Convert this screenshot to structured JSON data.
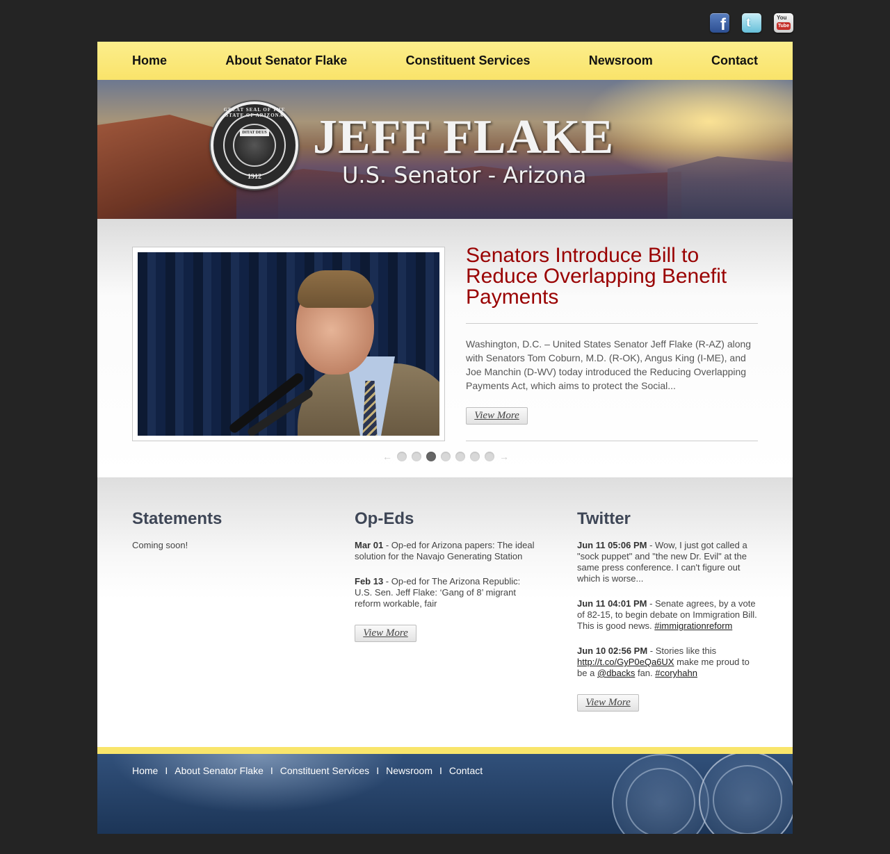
{
  "social": {
    "facebook": "f",
    "twitter": "t",
    "youtube_top": "You",
    "youtube_bottom": "Tube"
  },
  "nav": [
    "Home",
    "About Senator Flake",
    "Constituent Services",
    "Newsroom",
    "Contact"
  ],
  "banner": {
    "name": "JEFF FLAKE",
    "subtitle": "U.S. Senator - Arizona",
    "seal_text": "GREAT SEAL OF THE STATE OF ARIZONA",
    "seal_motto": "DITAT DEUS",
    "seal_year": "1912"
  },
  "feature": {
    "headline": "Senators Introduce Bill to Reduce Overlapping Benefit Payments",
    "summary": "Washington, D.C. – United States Senator Jeff Flake (R-AZ) along with Senators Tom Coburn, M.D. (R-OK), Angus King (I-ME), and Joe Manchin (D-WV) today introduced the Reducing Overlapping Payments Act, which aims to protect the Social...",
    "button": "View More",
    "pager": {
      "prev": "←",
      "next": "→",
      "count": 7,
      "active": 3
    }
  },
  "statements": {
    "title": "Statements",
    "text": "Coming soon!"
  },
  "opeds": {
    "title": "Op-Eds",
    "items": [
      {
        "date": "Mar 01",
        "text": "Op-ed for Arizona papers: The ideal solution for the Navajo Generating Station"
      },
      {
        "date": "Feb 13",
        "text": "Op-ed for The Arizona Republic: U.S. Sen. Jeff Flake: ‘Gang of 8’ migrant reform workable, fair"
      }
    ],
    "button": "View More"
  },
  "twitter": {
    "title": "Twitter",
    "items": [
      {
        "date": "Jun 11 05:06 PM",
        "text": "Wow, I just got called a \"sock puppet\" and \"the new Dr. Evil\" at the same press conference. I can't figure out which is worse..."
      },
      {
        "date": "Jun 11 04:01 PM",
        "text": "Senate agrees, by a vote of 82-15, to begin debate on Immigration Bill. This is good news.",
        "tag": "#immigrationreform"
      },
      {
        "date": "Jun 10 02:56 PM",
        "pre": "Stories like this",
        "link": "http://t.co/GyP0eQa6UX",
        "mid": "make me proud to be a",
        "handle": "@dbacks",
        "post": "fan.",
        "tag": "#coryhahn"
      }
    ],
    "button": "View More"
  },
  "footer_nav": [
    "Home",
    "About Senator Flake",
    "Constituent Services",
    "Newsroom",
    "Contact"
  ],
  "footer_sep": "I",
  "colors": {
    "nav_yellow": "#f9e56b",
    "headline_red": "#990000",
    "heading_slate": "#3e4656",
    "page_bg": "#242424"
  }
}
